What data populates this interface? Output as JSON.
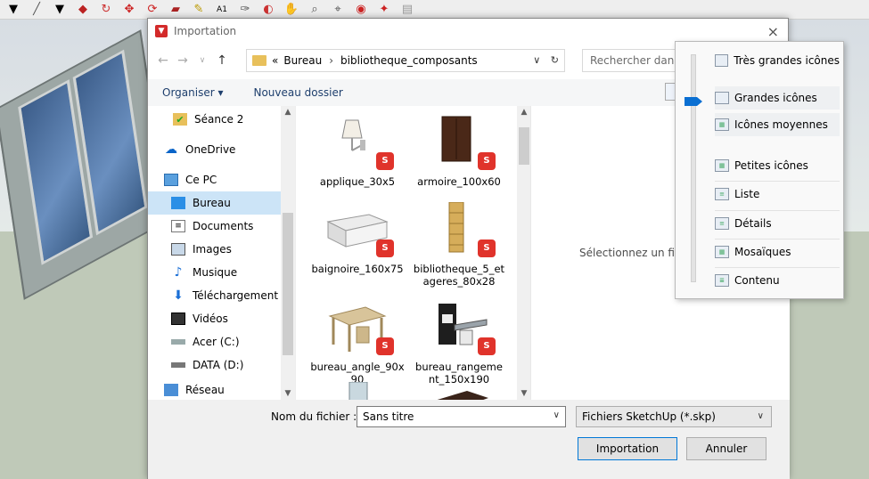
{
  "dialog": {
    "title": "Importation",
    "close_glyph": "×",
    "nav": {
      "back": "←",
      "forward": "→",
      "recent": "∨",
      "up": "↑"
    },
    "address": {
      "prefix": "«",
      "crumbs": [
        "Bureau",
        "bibliotheque_composants"
      ],
      "separator": "›",
      "dropdown": "∨",
      "refresh": "↻"
    },
    "search_placeholder": "Rechercher dans",
    "commands": {
      "organize": "Organiser ▾",
      "new_folder": "Nouveau dossier"
    },
    "nav_pane": {
      "items": [
        {
          "label": "Séance 2",
          "icon": "folder-check-icon"
        },
        {
          "label": "OneDrive",
          "icon": "cloud-icon"
        },
        {
          "label": "Ce PC",
          "icon": "computer-icon"
        },
        {
          "label": "Bureau",
          "icon": "desktop-icon",
          "selected": true
        },
        {
          "label": "Documents",
          "icon": "documents-icon"
        },
        {
          "label": "Images",
          "icon": "images-icon"
        },
        {
          "label": "Musique",
          "icon": "music-icon"
        },
        {
          "label": "Téléchargement",
          "icon": "download-icon"
        },
        {
          "label": "Vidéos",
          "icon": "videos-icon"
        },
        {
          "label": "Acer (C:)",
          "icon": "drive-icon"
        },
        {
          "label": "DATA (D:)",
          "icon": "drive-icon"
        },
        {
          "label": "Réseau",
          "icon": "network-icon"
        }
      ]
    },
    "files": [
      {
        "name": "applique_30x5",
        "icon": "lamp-icon"
      },
      {
        "name": "armoire_100x60",
        "icon": "wardrobe-icon"
      },
      {
        "name": "baignoire_160x75",
        "icon": "bathtub-icon"
      },
      {
        "name": "bibliotheque_5_et agers_80x28",
        "name_lines": [
          "bibliotheque_5_et",
          "ageres_80x28"
        ],
        "icon": "bookshelf-icon"
      },
      {
        "name": "bureau_angle_90x 90",
        "name_lines": [
          "bureau_angle_90x",
          "90"
        ],
        "icon": "desk-icon"
      },
      {
        "name": "bureau_rangeme nt_150x190",
        "name_lines": [
          "bureau_rangeme",
          "nt_150x190"
        ],
        "icon": "office-desk-icon"
      }
    ],
    "preview_text": "Sélectionnez un fic",
    "filename_label": "Nom du fichier :",
    "filename_value": "Sans titre",
    "filter_value": "Fichiers SketchUp (*.skp)",
    "import_button": "Importation",
    "cancel_button": "Annuler"
  },
  "view_menu": {
    "items": [
      "Très grandes icônes",
      "Grandes icônes",
      "Icônes moyennes",
      "Petites icônes",
      "Liste",
      "Détails",
      "Mosaïques",
      "Contenu"
    ],
    "selected_index": 1
  },
  "colors": {
    "accent": "#0078d7",
    "selected_nav": "#cce4f7",
    "sketchup_red": "#e0332b"
  }
}
